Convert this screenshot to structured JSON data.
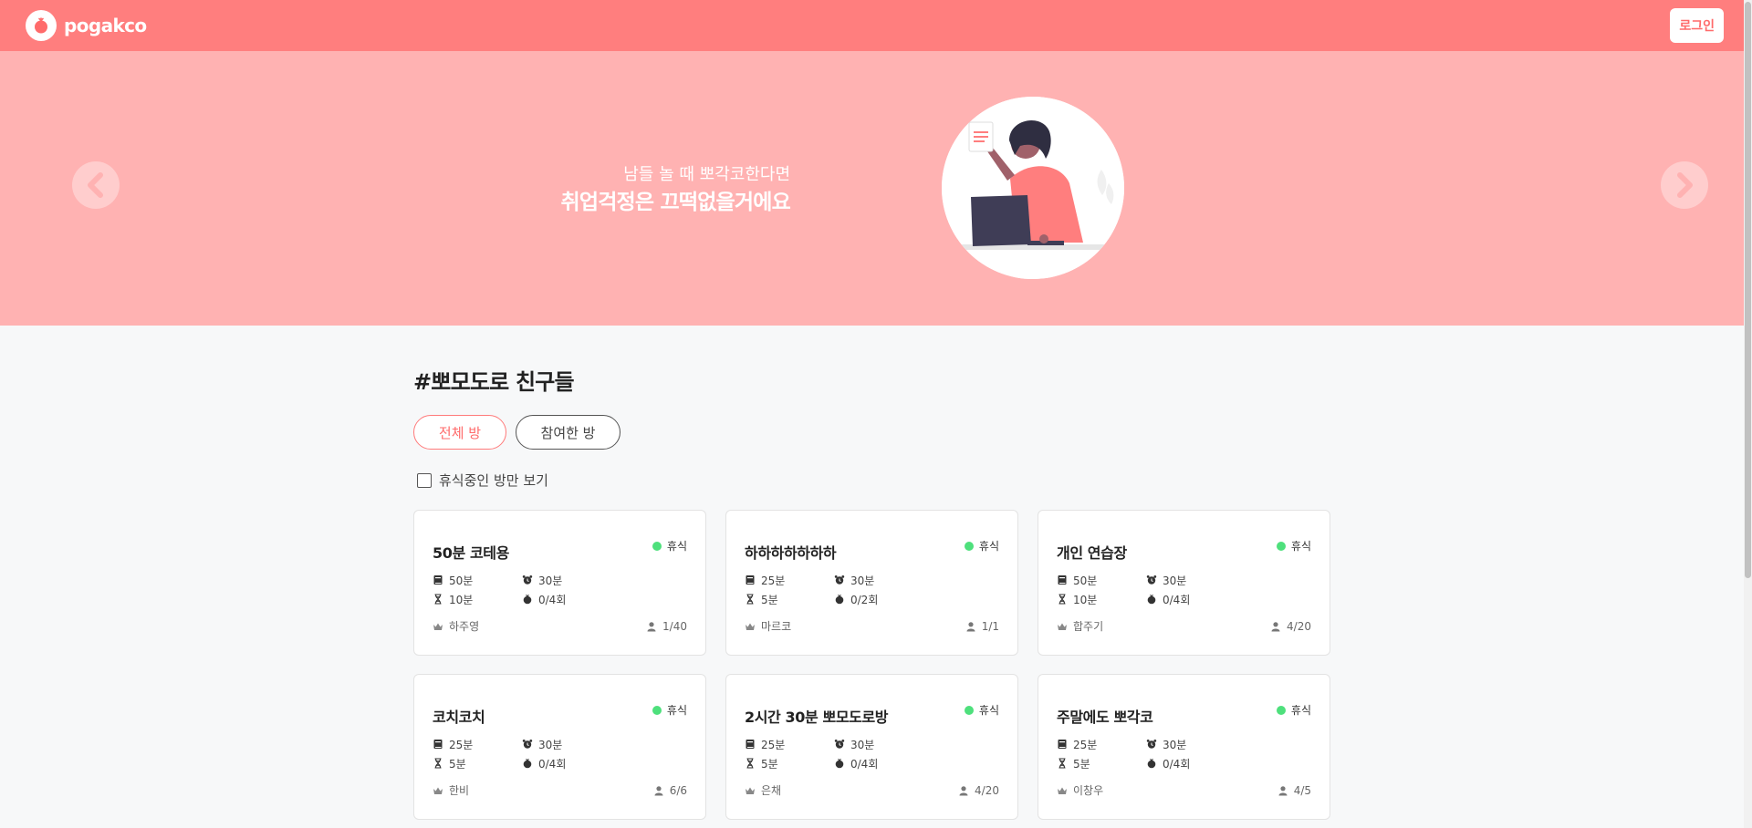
{
  "header": {
    "logo": "pogakco",
    "login_label": "로그인"
  },
  "banner": {
    "subtitle": "남들 놀 때 뽀각코한다면",
    "headline": "취업걱정은 끄떡없을거에요"
  },
  "section": {
    "title": "#뽀모도로 친구들"
  },
  "tabs": [
    {
      "label": "전체 방",
      "active": true
    },
    {
      "label": "참여한 방",
      "active": false
    }
  ],
  "filter": {
    "label": "휴식중인 방만 보기",
    "checked": false
  },
  "colors": {
    "brand": "#ff7e7e",
    "banner": "#ffb2b2",
    "status_rest": "#4ee07c"
  },
  "rooms": [
    {
      "title": "50분 코테용",
      "status": "휴식",
      "focus": "50분",
      "rest": "10분",
      "long_rest": "30분",
      "cycles": "0/4회",
      "host": "하주영",
      "members": "1/40"
    },
    {
      "title": "하하하하하하하",
      "status": "휴식",
      "focus": "25분",
      "rest": "5분",
      "long_rest": "30분",
      "cycles": "0/2회",
      "host": "마르코",
      "members": "1/1"
    },
    {
      "title": "개인 연습장",
      "status": "휴식",
      "focus": "50분",
      "rest": "10분",
      "long_rest": "30분",
      "cycles": "0/4회",
      "host": "합주기",
      "members": "4/20"
    },
    {
      "title": "코치코치",
      "status": "휴식",
      "focus": "25분",
      "rest": "5분",
      "long_rest": "30분",
      "cycles": "0/4회",
      "host": "한비",
      "members": "6/6"
    },
    {
      "title": "2시간 30분 뽀모도로방",
      "status": "휴식",
      "focus": "25분",
      "rest": "5분",
      "long_rest": "30분",
      "cycles": "0/4회",
      "host": "은채",
      "members": "4/20"
    },
    {
      "title": "주말에도 뽀각코",
      "status": "휴식",
      "focus": "25분",
      "rest": "5분",
      "long_rest": "30분",
      "cycles": "0/4회",
      "host": "이창우",
      "members": "4/5"
    }
  ]
}
